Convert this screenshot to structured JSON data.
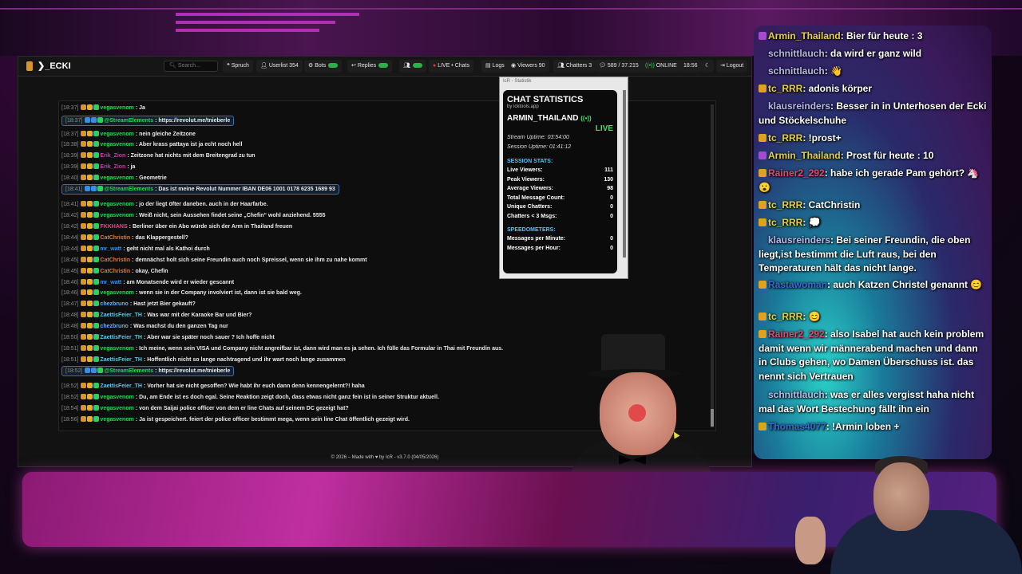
{
  "app": {
    "brand": "ECKI",
    "search_placeholder": "Search...",
    "nav": [
      {
        "name": "nav-spruch",
        "label": "Spruch"
      },
      {
        "name": "nav-userlist",
        "label": "Userlist 354"
      },
      {
        "name": "nav-bots",
        "label": "Bots"
      },
      {
        "name": "nav-replies",
        "label": "Replies"
      },
      {
        "name": "nav-live-chats",
        "label": "LIVE • Chats"
      },
      {
        "name": "nav-logs",
        "label": "Logs"
      },
      {
        "name": "nav-viewers",
        "label": "Viewers 90"
      },
      {
        "name": "nav-chatters",
        "label": "Chatters 3"
      },
      {
        "name": "nav-messages",
        "label": "589 / 37.215"
      },
      {
        "name": "nav-online",
        "label": "ONLINE"
      },
      {
        "name": "nav-time",
        "label": "18:56"
      },
      {
        "name": "nav-logout",
        "label": "Logout"
      }
    ],
    "footer": "© 2026 – Made with ♥ by IcR - v3.7.0 (04/05/2026)"
  },
  "messages": [
    {
      "time": "[18:37]",
      "user": "vegasvenom",
      "ucolor": "#2bd060",
      "text": "Ja",
      "hl": false
    },
    {
      "time": "[18:37]",
      "user": "@StreamElements",
      "ucolor": "#2bd060",
      "text": "https://revolut.me/tnieberle",
      "hl": true
    },
    {
      "time": "[18:37]",
      "user": "vegasvenom",
      "ucolor": "#2bd060",
      "text": "nein gleiche Zeitzone",
      "hl": false
    },
    {
      "time": "[18:38]",
      "user": "vegasvenom",
      "ucolor": "#2bd060",
      "text": "Aber krass pattaya ist ja echt noch hell",
      "hl": false
    },
    {
      "time": "[18:39]",
      "user": "Erik_Zion",
      "ucolor": "#c43bb0",
      "text": "Zeitzone hat nichts mit dem Breitengrad zu tun",
      "hl": false
    },
    {
      "time": "[18:39]",
      "user": "Erik_Zion",
      "ucolor": "#c43bb0",
      "text": "ja",
      "hl": false
    },
    {
      "time": "[18:40]",
      "user": "vegasvenom",
      "ucolor": "#2bd060",
      "text": "Geometrie",
      "hl": false
    },
    {
      "time": "[18:41]",
      "user": "@StreamElements",
      "ucolor": "#2bd060",
      "text": "Das ist meine Revolut Nummer IBAN DE06 1001 0178 6235 1689 93",
      "hl": true
    },
    {
      "time": "[18:41]",
      "user": "vegasvenom",
      "ucolor": "#2bd060",
      "text": "jo der liegt öfter daneben. auch in der Haarfarbe.",
      "hl": false
    },
    {
      "time": "[18:42]",
      "user": "vegasvenom",
      "ucolor": "#2bd060",
      "text": "Weiß nicht, sein Aussehen findet seine „Chefin“ wohl anziehend. 5555",
      "hl": false
    },
    {
      "time": "[18:42]",
      "user": "FKKHANS",
      "ucolor": "#e0458a",
      "text": "Berliner über ein Abo würde sich der Arm in Thailand freuen",
      "hl": false
    },
    {
      "time": "[18:44]",
      "user": "CatChristin",
      "ucolor": "#e07a3a",
      "text": "das Klappergestell?",
      "hl": false
    },
    {
      "time": "[18:44]",
      "user": "mr_watt",
      "ucolor": "#3a8ee0",
      "text": "geht nicht mal als Kathoi durch",
      "hl": false
    },
    {
      "time": "[18:45]",
      "user": "CatChristin",
      "ucolor": "#e07a3a",
      "text": "demnächst holt sich seine Freundin auch noch Spreissel, wenn sie ihm zu nahe kommt",
      "hl": false
    },
    {
      "time": "[18:45]",
      "user": "CatChristin",
      "ucolor": "#e07a3a",
      "text": "okay, Chefin",
      "hl": false
    },
    {
      "time": "[18:46]",
      "user": "mr_watt",
      "ucolor": "#3a8ee0",
      "text": "am Monatsende wird er wieder gescannt",
      "hl": false
    },
    {
      "time": "[18:46]",
      "user": "vegasvenom",
      "ucolor": "#2bd060",
      "text": "wenn sie in der Company involviert ist, dann ist sie bald weg.",
      "hl": false
    },
    {
      "time": "[18:47]",
      "user": "chezbruno",
      "ucolor": "#6ab0f0",
      "text": "Hast jetzt Bier gekauft?",
      "hl": false
    },
    {
      "time": "[18:48]",
      "user": "ZaettisFeier_TH",
      "ucolor": "#5ac8e8",
      "text": "Was war mit der Karaoke Bar und Bier?",
      "hl": false
    },
    {
      "time": "[18:48]",
      "user": "chezbruno",
      "ucolor": "#6ab0f0",
      "text": "Was machst du den ganzen Tag nur",
      "hl": false
    },
    {
      "time": "[18:50]",
      "user": "ZaettisFeier_TH",
      "ucolor": "#5ac8e8",
      "text": "Aber war sie später noch sauer ? Ich hoffe nicht",
      "hl": false
    },
    {
      "time": "[18:51]",
      "user": "vegasvenom",
      "ucolor": "#2bd060",
      "text": "Ich meine, wenn sein VISA und Company nicht angreifbar ist, dann wird man es ja sehen. Ich fülle das Formular in Thai mit Freundin aus.",
      "hl": false
    },
    {
      "time": "[18:51]",
      "user": "ZaettisFeier_TH",
      "ucolor": "#5ac8e8",
      "text": "Hoffentlich nicht so lange nachtragend und ihr wart noch lange zusammen",
      "hl": false
    },
    {
      "time": "[18:52]",
      "user": "@StreamElements",
      "ucolor": "#2bd060",
      "text": "https://revolut.me/tnieberle",
      "hl": true
    },
    {
      "time": "[18:52]",
      "user": "ZaettisFeier_TH",
      "ucolor": "#5ac8e8",
      "text": "Vorher hat sie nicht gesoffen? Wie habt ihr euch dann denn kennengelernt?! haha",
      "hl": false
    },
    {
      "time": "[18:52]",
      "user": "vegasvenom",
      "ucolor": "#2bd060",
      "text": "Du, am Ende ist es doch egal. Seine Reaktion zeigt doch, dass etwas nicht ganz fein ist in seiner Struktur aktuell.",
      "hl": false
    },
    {
      "time": "[18:54]",
      "user": "vegasvenom",
      "ucolor": "#2bd060",
      "text": "von dem Saijai police officer von dem er line Chats auf seinem DC gezeigt hat?",
      "hl": false
    },
    {
      "time": "[18:56]",
      "user": "vegasvenom",
      "ucolor": "#2bd060",
      "text": "Ja ist gespeichert. feiert der police officer bestimmt mega, wenn sein line Chat öffentlich gezeigt wird.",
      "hl": false
    }
  ],
  "stats": {
    "caption": "IcR - Statistik",
    "title": "CHAT STATISTICS",
    "by": "by icktools.app",
    "user": "ARMIN_THAILAND",
    "live": "LIVE",
    "stream_uptime": "Stream Uptime: 03:54:00",
    "session_uptime": "Session Uptime: 01:41:12",
    "session_title": "SESSION STATS:",
    "session": [
      {
        "label": "Live Viewers:",
        "value": "111"
      },
      {
        "label": "Peak Viewers:",
        "value": "130"
      },
      {
        "label": "Average Viewers:",
        "value": "98"
      },
      {
        "label": "Total Message Count:",
        "value": "0"
      },
      {
        "label": "Unique Chatters:",
        "value": "0"
      },
      {
        "label": "Chatters < 3 Msgs:",
        "value": "0"
      }
    ],
    "speed_title": "SPEEDOMETERS:",
    "speed": [
      {
        "label": "Messages per Minute:",
        "value": "0"
      },
      {
        "label": "Messages per Hour:",
        "value": "0"
      }
    ]
  },
  "side_chat": [
    {
      "user": "Armin_Thailand",
      "ucolor": "#e8d23a",
      "text": ": Bier für heute : 3"
    },
    {
      "user": "schnittlauch",
      "ucolor": "#b8b8e8",
      "text": ": da wird er ganz wild"
    },
    {
      "user": "schnittlauch",
      "ucolor": "#b8b8e8",
      "text": ": 👋"
    },
    {
      "user": "tc_RRR",
      "ucolor": "#e8d23a",
      "text": ": adonis körper"
    },
    {
      "user": "klausreinders",
      "ucolor": "#b8b8e8",
      "text": ": Besser in in Unterhosen der Ecki und Stöckelschuhe"
    },
    {
      "user": "tc_RRR",
      "ucolor": "#e8d23a",
      "text": ": !prost+"
    },
    {
      "user": "Armin_Thailand",
      "ucolor": "#e8d23a",
      "text": ": Prost für heute : 10"
    },
    {
      "user": "Rainer2_292",
      "ucolor": "#e04a6a",
      "text": ": habe ich gerade Pam gehört? 🦄 😮"
    },
    {
      "user": "tc_RRR",
      "ucolor": "#e8d23a",
      "text": ": CatChristin"
    },
    {
      "user": "tc_RRR",
      "ucolor": "#e8d23a",
      "text": ": 💭"
    },
    {
      "user": "klausreinders",
      "ucolor": "#b8b8e8",
      "text": ": Bei seiner Freundin, die oben liegt,ist bestimmt die Luft raus, bei den Temperaturen hält das nicht lange."
    },
    {
      "user": "Rastawoman",
      "ucolor": "#3a6ad0",
      "text": ": auch Katzen Christel genannt 😊"
    },
    {
      "user": "tc_RRR",
      "ucolor": "#e8d23a",
      "text": ": 😊"
    },
    {
      "user": "Rainer2_292",
      "ucolor": "#e04a6a",
      "text": ": also Isabel hat auch kein problem damit wenn wir männerabend machen und dann in Clubs gehen, wo Damen Überschuss ist. das nennt sich Vertrauen"
    },
    {
      "user": "schnittlauch",
      "ucolor": "#b8b8e8",
      "text": ": was er alles vergisst haha nicht mal das Wort Bestechung fällt ihn ein"
    },
    {
      "user": "Thomas4077",
      "ucolor": "#3a6ad0",
      "text": ": !Armin loben +"
    }
  ]
}
